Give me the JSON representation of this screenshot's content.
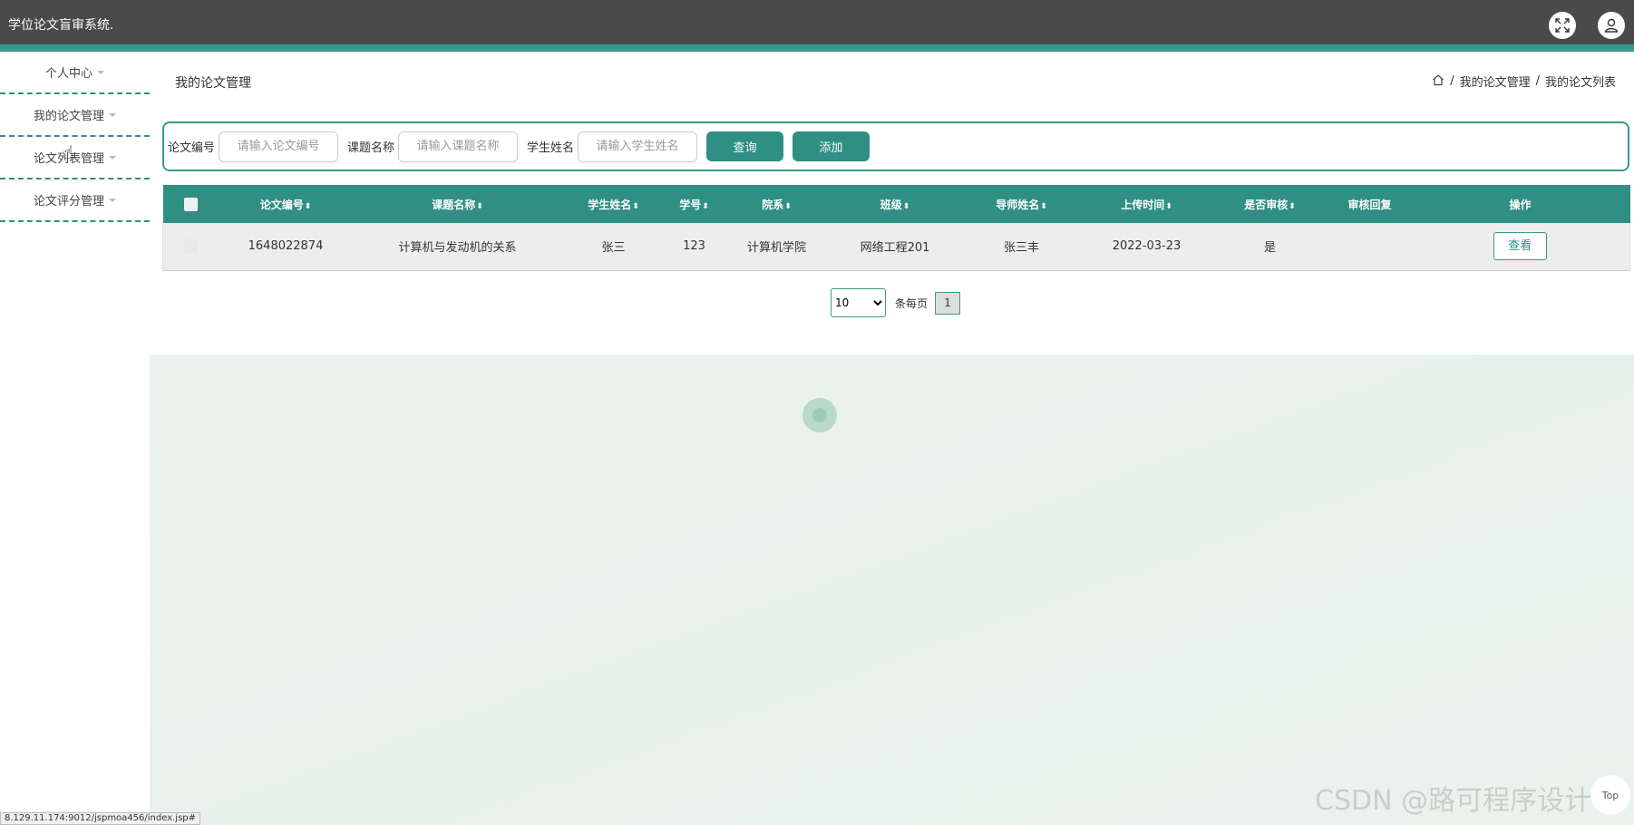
{
  "app": {
    "title": "学位论文盲审系统."
  },
  "sidebar": {
    "items": [
      {
        "label": "个人中心"
      },
      {
        "label": "我的论文管理"
      },
      {
        "label": "论文列表管理"
      },
      {
        "label": "论文评分管理"
      }
    ]
  },
  "page": {
    "title": "我的论文管理",
    "breadcrumb": [
      "我的论文管理",
      "我的论文列表"
    ],
    "breadcrumb_sep": "/"
  },
  "search": {
    "fields": [
      {
        "label": "论文编号",
        "placeholder": "请输入论文编号"
      },
      {
        "label": "课题名称",
        "placeholder": "请输入课题名称"
      },
      {
        "label": "学生姓名",
        "placeholder": "请输入学生姓名"
      }
    ],
    "query_label": "查询",
    "add_label": "添加"
  },
  "table": {
    "columns": [
      "论文编号",
      "课题名称",
      "学生姓名",
      "学号",
      "院系",
      "班级",
      "导师姓名",
      "上传时间",
      "是否审核",
      "审核回复",
      "操作"
    ],
    "rows": [
      {
        "paper_no": "1648022874",
        "topic": "计算机与发动机的关系",
        "student_name": "张三",
        "student_no": "123",
        "department": "计算机学院",
        "class": "网络工程201",
        "advisor": "张三丰",
        "upload_time": "2022-03-23",
        "reviewed": "是",
        "review_reply": "",
        "action_label": "查看"
      }
    ]
  },
  "pager": {
    "page_size": "10",
    "per_page_label": "条每页",
    "current_page": "1"
  },
  "watermark": "CSDN @路可程序设计",
  "top_button": "Top",
  "status_url": "8.129.11.174:9012/jspmoa456/index.jsp#",
  "colors": {
    "topbar": "#4a4a4a",
    "accent": "#2e8f82"
  }
}
